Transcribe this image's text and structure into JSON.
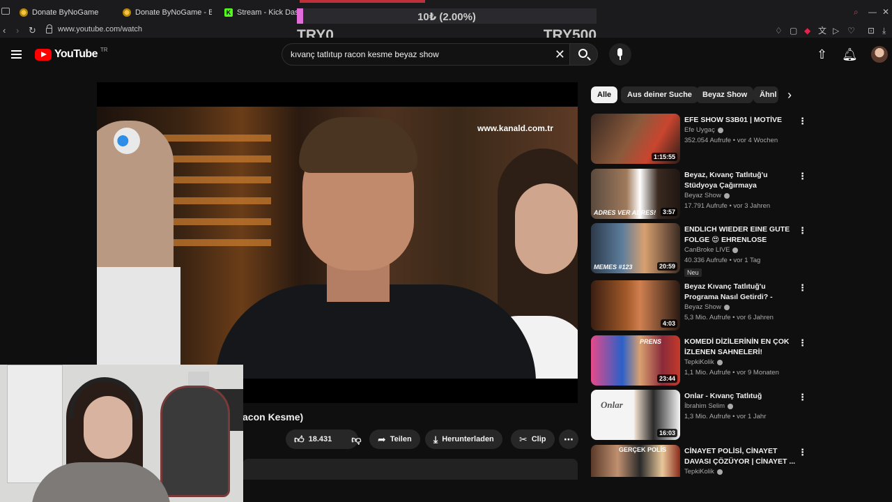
{
  "browser": {
    "tabs": [
      {
        "label": "Donate ByNoGame"
      },
      {
        "label": "Donate ByNoGame - BNG"
      },
      {
        "label": "Stream - Kick Dashb"
      }
    ],
    "url": "www.youtube.com/watch"
  },
  "donation": {
    "goal_text": "10₺ (2.00%)",
    "progress": 0.02,
    "min_label": "TRY0",
    "max_label": "TRY500",
    "fill_color": "#e26cd9"
  },
  "youtube": {
    "logo_text": "YouTube",
    "country_code": "TR",
    "search_query": "kıvanç tatlıtup racon kesme beyaz show"
  },
  "player": {
    "watermark": "www.kanald.com.tr"
  },
  "video": {
    "title_fragment": "acon Kesme)",
    "likes": "18.431",
    "share_label": "Teilen",
    "download_label": "Herunterladen",
    "clip_label": "Clip"
  },
  "chips": [
    {
      "label": "Alle",
      "active": true
    },
    {
      "label": "Aus deiner Suche"
    },
    {
      "label": "Beyaz Show"
    },
    {
      "label": "Ähnl"
    }
  ],
  "related": [
    {
      "title": "EFE SHOW S3B01 | MOTİVE",
      "channel": "Efe Uygaç",
      "meta": "352.054 Aufrufe • vor 4 Wochen",
      "duration": "1:15:55"
    },
    {
      "title": "Beyaz, Kıvanç Tatlıtuğ'u Stüdyoya Çağırmaya Kalkarsa!...",
      "channel": "Beyaz Show",
      "meta": "17.791 Aufrufe • vor 3 Jahren",
      "duration": "3:57",
      "thumb_text": "ADRES VER ADRES!"
    },
    {
      "title": "ENDLICH WIEDER EINE GUTE FOLGE 😍 EHRENLOSE MEME...",
      "channel": "CanBroke LIVE",
      "meta": "40.336 Aufrufe • vor 1 Tag",
      "duration": "20:59",
      "thumb_text": "MEMES #123",
      "badge": "Neu"
    },
    {
      "title": "Beyaz Kıvanç Tatlıtuğ'u Programa Nasıl Getirdi? - Beya...",
      "channel": "Beyaz Show",
      "meta": "5,3 Mio. Aufrufe • vor 6 Jahren",
      "duration": "4:03"
    },
    {
      "title": "KOMEDİ DİZİLERİNİN EN ÇOK İZLENEN SAHNELERİ!",
      "channel": "TepkiKolik",
      "meta": "1,1 Mio. Aufrufe • vor 9 Monaten",
      "duration": "23:44",
      "thumb_text": "PRENS"
    },
    {
      "title": "Onlar - Kıvanç Tatlıtuğ",
      "channel": "İbrahim Selim",
      "meta": "1,3 Mio. Aufrufe • vor 1 Jahr",
      "duration": "16:03",
      "thumb_text": "Onlar"
    },
    {
      "title": "CİNAYET POLİSİ, CİNAYET DAVASI ÇÖZÜYOR | CİNAYET ...",
      "channel": "TepkiKolik",
      "meta": "",
      "duration": "",
      "thumb_text": "GERÇEK POLİS"
    }
  ]
}
